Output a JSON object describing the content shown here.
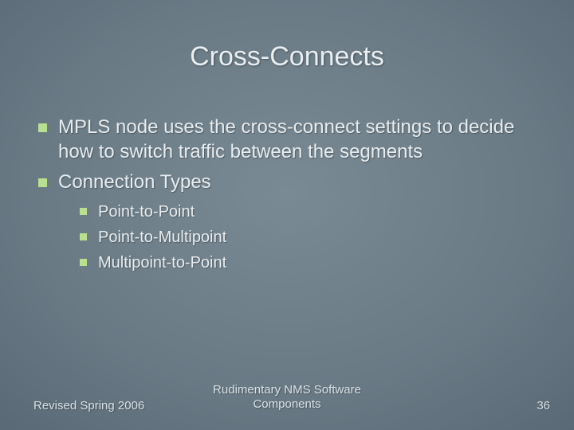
{
  "title": "Cross-Connects",
  "body": {
    "items": [
      {
        "text": "MPLS node uses the cross-connect settings to decide how to switch traffic between the segments"
      },
      {
        "text": "Connection Types",
        "children": [
          {
            "text": "Point-to-Point"
          },
          {
            "text": "Point-to-Multipoint"
          },
          {
            "text": "Multipoint-to-Point"
          }
        ]
      }
    ]
  },
  "footer": {
    "left": "Revised Spring 2006",
    "center_line1": "Rudimentary NMS Software",
    "center_line2": "Components",
    "right": "36"
  }
}
